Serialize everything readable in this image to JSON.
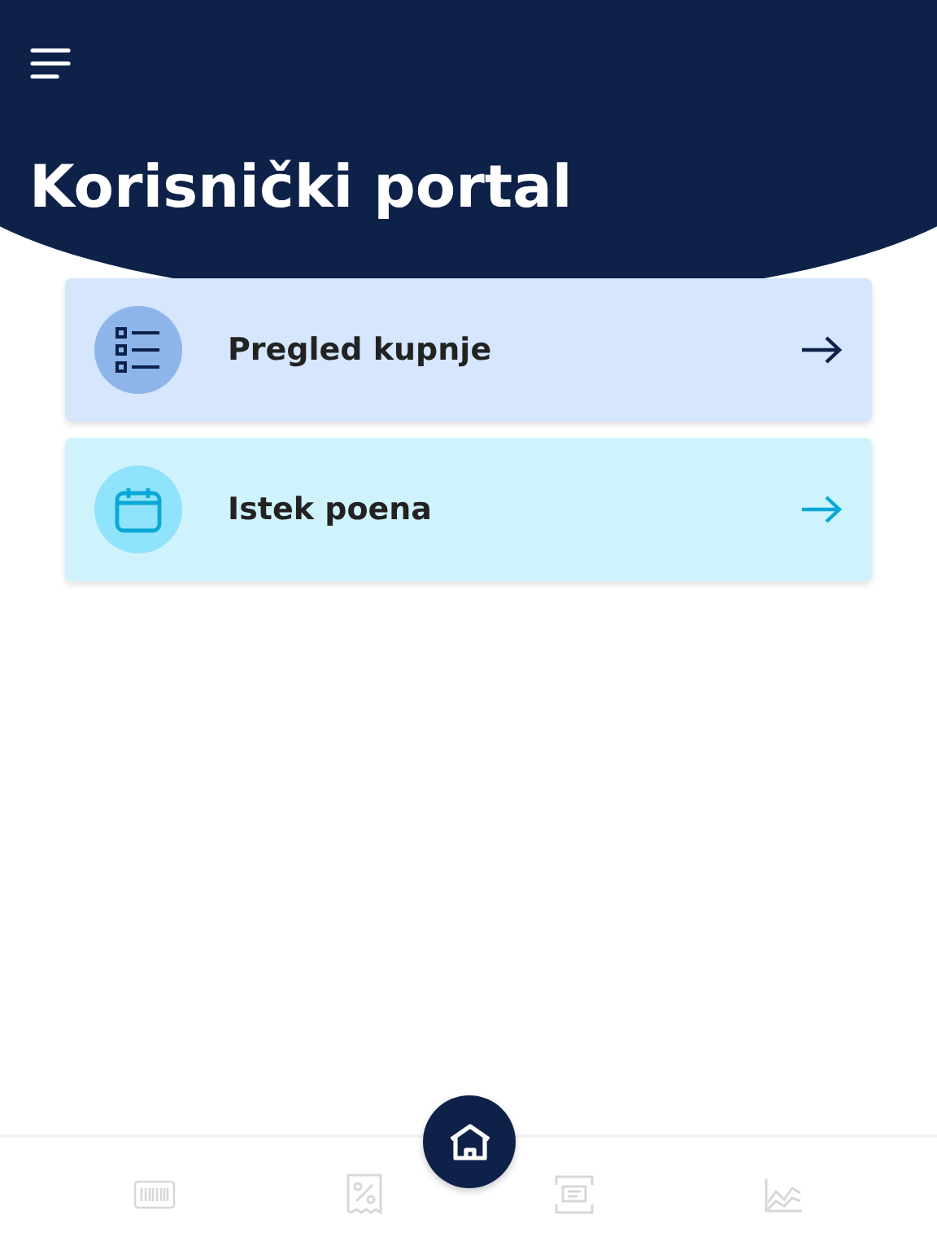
{
  "header": {
    "title": "Korisnički portal"
  },
  "cards": [
    {
      "kind": "list",
      "label": "Pregled kupnje"
    },
    {
      "kind": "calendar",
      "label": "Istek poena"
    }
  ],
  "nav": [
    {
      "kind": "barcode",
      "selected": false
    },
    {
      "kind": "receipt",
      "selected": false
    },
    {
      "kind": "home",
      "selected": true
    },
    {
      "kind": "scan",
      "selected": false
    },
    {
      "kind": "chart",
      "selected": false
    }
  ]
}
